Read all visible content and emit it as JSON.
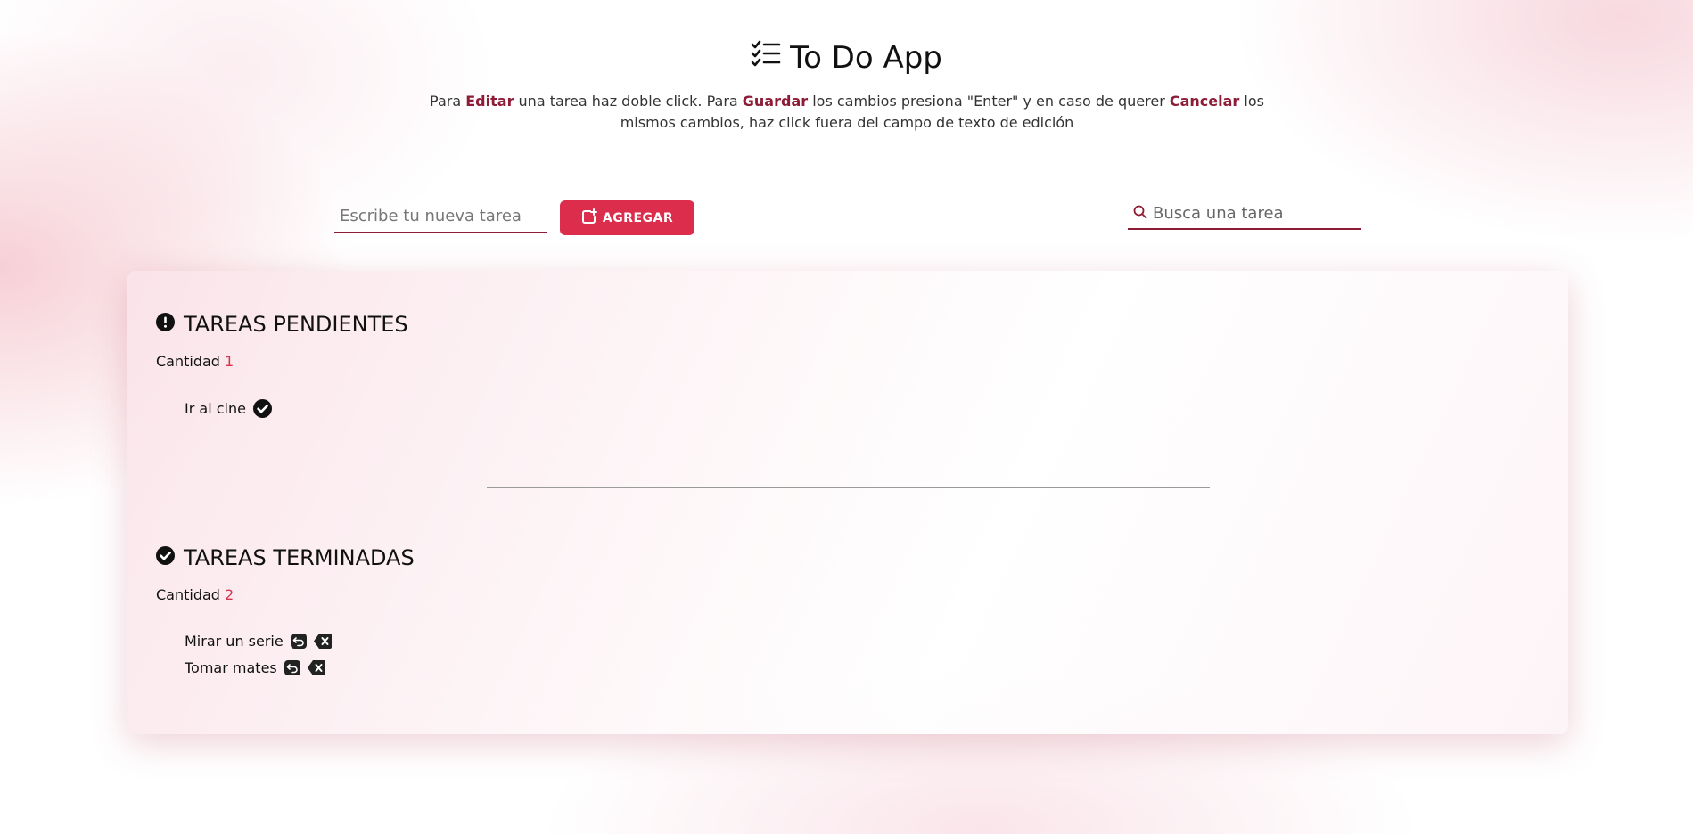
{
  "header": {
    "title": "To Do App",
    "title_icon": "checklist-icon",
    "instructions": {
      "t1": "Para ",
      "edit": "Editar",
      "t2": " una tarea haz doble click. Para ",
      "save": "Guardar",
      "t3": " los cambios presiona \"Enter\" y en caso de querer ",
      "cancel": "Cancelar",
      "t4": " los mismos cambios, haz click fuera del campo de texto de edición"
    }
  },
  "new_task": {
    "placeholder": "Escribe tu nueva tarea",
    "value": ""
  },
  "add_button": {
    "label": "AGREGAR",
    "icon": "add-note-icon"
  },
  "search": {
    "placeholder": "Busca una tarea",
    "value": "",
    "icon": "search-icon"
  },
  "pending": {
    "title": "TAREAS PENDIENTES",
    "icon": "exclamation-circle-icon",
    "count_label": "Cantidad",
    "count": "1",
    "tasks": [
      {
        "text": "Ir al cine",
        "action_icon": "check-circle-icon"
      }
    ]
  },
  "done": {
    "title": "TAREAS TERMINADAS",
    "icon": "check-circle-icon",
    "count_label": "Cantidad",
    "count": "2",
    "tasks": [
      {
        "text": "Mirar un serie",
        "action_icons": [
          "undo-icon",
          "delete-icon"
        ]
      },
      {
        "text": "Tomar mates",
        "action_icons": [
          "undo-icon",
          "delete-icon"
        ]
      }
    ]
  },
  "colors": {
    "accent": "#dd2d4d",
    "dark_accent": "#8e1c36",
    "count_number": "#d4344f"
  }
}
